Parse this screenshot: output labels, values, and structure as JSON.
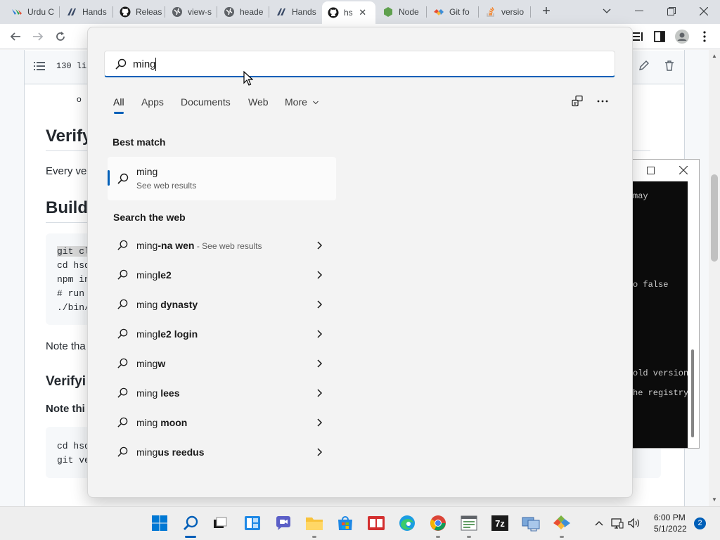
{
  "browser": {
    "tabs": [
      {
        "label": "Urdu C",
        "icon": "tab-favicon-urdu"
      },
      {
        "label": "Hands",
        "icon": "tab-favicon-hands"
      },
      {
        "label": "Releas",
        "icon": "github-icon"
      },
      {
        "label": "view-s",
        "icon": "globe-icon"
      },
      {
        "label": "heade",
        "icon": "globe-icon"
      },
      {
        "label": "Hands",
        "icon": "tab-favicon-hands"
      },
      {
        "label": "hs",
        "icon": "github-icon"
      },
      {
        "label": "Node",
        "icon": "nodejs-icon"
      },
      {
        "label": "Git fo",
        "icon": "git-for-windows-icon"
      },
      {
        "label": "versio",
        "icon": "stackoverflow-icon"
      }
    ],
    "active_tab_index": 6
  },
  "page": {
    "lines_label": "130 lin",
    "bullet": "o",
    "heading_verify": "Verify",
    "text_every": "Every ve",
    "heading_build": "Buildi",
    "code1": [
      "git cl",
      "cd hsd",
      "npm in",
      "# run",
      "./bin/"
    ],
    "text_note": "Note tha",
    "heading_verifying": "Verifyi",
    "text_note_this": "Note thi",
    "code2": [
      "cd hsd",
      "git ve"
    ]
  },
  "terminal": {
    "lines": [
      "may",
      "o false",
      "old version",
      "he registry"
    ]
  },
  "search": {
    "query": "ming",
    "tabs": [
      "All",
      "Apps",
      "Documents",
      "Web",
      "More"
    ],
    "best_match_heading": "Best match",
    "best_match": {
      "title": "ming",
      "subtitle": "See web results"
    },
    "web_heading": "Search the web",
    "web_results": [
      {
        "prefix": "ming",
        "bold": "-na wen",
        "suffix": " - See web results"
      },
      {
        "prefix": "ming",
        "bold": "le2",
        "suffix": ""
      },
      {
        "prefix": "ming",
        "bold": " dynasty",
        "suffix": ""
      },
      {
        "prefix": "ming",
        "bold": "le2 login",
        "suffix": ""
      },
      {
        "prefix": "ming",
        "bold": "w",
        "suffix": ""
      },
      {
        "prefix": "ming",
        "bold": " lees",
        "suffix": ""
      },
      {
        "prefix": "ming",
        "bold": " moon",
        "suffix": ""
      },
      {
        "prefix": "ming",
        "bold": "us reedus",
        "suffix": ""
      }
    ]
  },
  "taskbar": {
    "time": "6:00 PM",
    "date": "5/1/2022",
    "notification_count": "2"
  },
  "colors": {
    "accent": "#005fb8",
    "flyout_bg": "#f3f3f3",
    "taskbar_bg": "#eeeeee"
  }
}
